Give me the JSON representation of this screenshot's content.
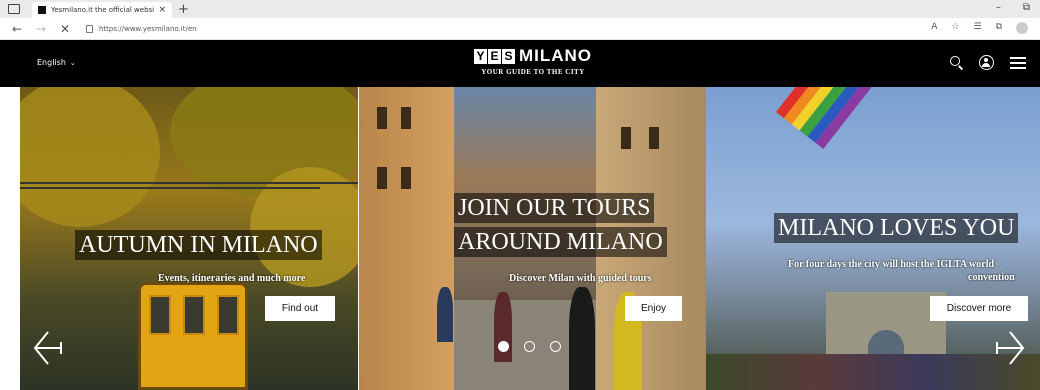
{
  "browser": {
    "tab_title": "Yesmilano.it the official website",
    "tab_close": "×",
    "new_tab": "+",
    "url": "https://www.yesmilano.it/en",
    "minimize": "–",
    "restore": "⧉"
  },
  "header": {
    "language": "English",
    "logo_yes": [
      "Y",
      "E",
      "S"
    ],
    "logo_milano": "MILANO",
    "tagline": "YOUR GUIDE TO THE CITY"
  },
  "slides": [
    {
      "headline": "AUTUMN IN MILANO",
      "subtitle": "Events, itineraries and much more",
      "cta": "Find out"
    },
    {
      "headline_line1": "JOIN OUR TOURS",
      "headline_line2": "AROUND MILANO",
      "subtitle": "Discover Milan with guided tours",
      "cta": "Enjoy"
    },
    {
      "headline": "MILANO LOVES YOU",
      "subtitle_line1": "For four days the city will host the IGLTA world",
      "subtitle_line2": "convention",
      "cta": "Discover more"
    }
  ],
  "carousel": {
    "slide_count": 3,
    "active_index": 0
  },
  "colors": {
    "header_bg": "#000000",
    "cta_bg": "#ffffff",
    "headline_bg": "rgba(0,0,0,0.55)"
  }
}
